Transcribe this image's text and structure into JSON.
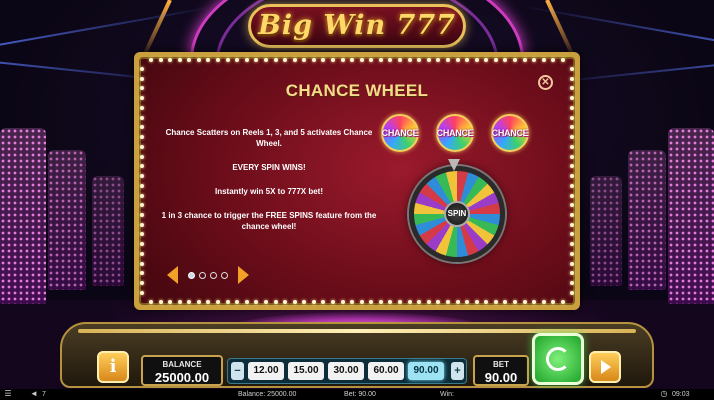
{
  "logo": {
    "text": "Big Win 777"
  },
  "panel": {
    "title": "CHANCE WHEEL",
    "paragraphs": [
      "Chance Scatters on Reels 1, 3, and 5 activates Chance Wheel.",
      "EVERY SPIN WINS!",
      "Instantly win 5X to 777X bet!",
      "1 in 3 chance to trigger the FREE SPINS feature from the chance wheel!"
    ],
    "badge_label": "CHANCE",
    "wheel_hub": "SPIN",
    "page_count": 4,
    "current_page": 1,
    "close_icon": "close-icon"
  },
  "console": {
    "balance_label": "BALANCE",
    "balance_value": "25000.00",
    "bet_label": "BET",
    "bet_value": "90.00",
    "bet_options": [
      "12.00",
      "15.00",
      "30.00",
      "60.00",
      "90.00"
    ],
    "selected_bet": "90.00",
    "minus": "−",
    "plus": "+",
    "info_symbol": "i"
  },
  "status_bar": {
    "sound_level": "7",
    "balance": "Balance: 25000.00",
    "bet": "Bet: 90.00",
    "win": "Win:",
    "time": "09:03"
  },
  "colors": {
    "panel_gold": "#c9a03d",
    "panel_red": "#9a1a2c",
    "title_gold": "#f3dc8a",
    "spin_green": "#1fa42a",
    "selected_chip": "#9de3f3"
  }
}
